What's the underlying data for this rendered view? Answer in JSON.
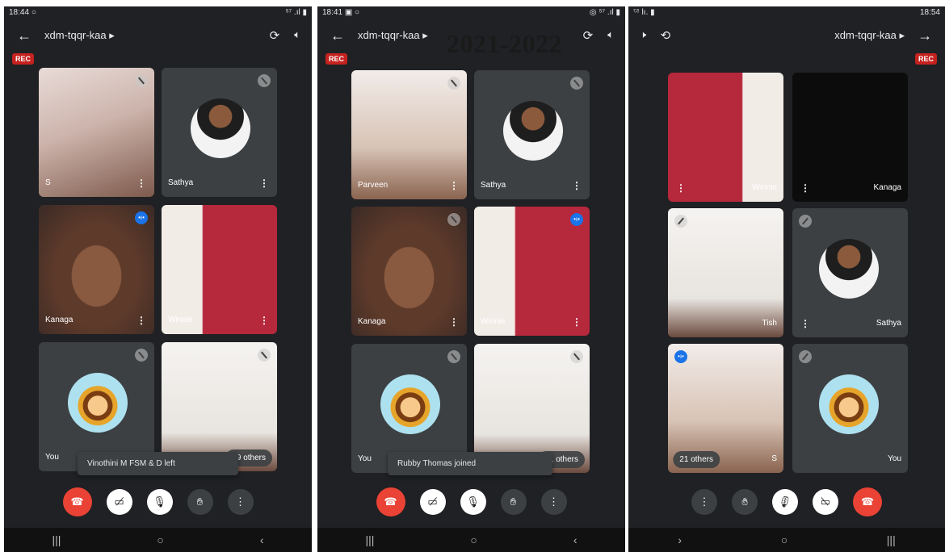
{
  "panel1": {
    "status_time": "18:44",
    "status_icons": "⁵⁷ .ıl ▮",
    "meeting_code": "xdm-tqqr-kaa ▸",
    "rec": "REC",
    "tiles": [
      {
        "name": "S"
      },
      {
        "name": "Sathya"
      },
      {
        "name": "Kanaga"
      },
      {
        "name": "Winnie"
      },
      {
        "name": "You"
      },
      {
        "name": ""
      }
    ],
    "others": "19 others",
    "toast": "Vinothini M FSM & D left"
  },
  "panel2": {
    "status_time": "18:41",
    "status_icons": "◎ ⁵⁷ .ıl ▮",
    "meeting_code": "xdm-tqqr-kaa ▸",
    "rec": "REC",
    "year_stamp": "2021-2022",
    "tiles": [
      {
        "name": "Parveen"
      },
      {
        "name": "Sathya"
      },
      {
        "name": "Kanaga"
      },
      {
        "name": "Winnie"
      },
      {
        "name": "You"
      },
      {
        "name": ""
      }
    ],
    "others": "21 others",
    "toast": "Rubby Thomas joined"
  },
  "panel3": {
    "status_time": "18:54",
    "meeting_code": "xdm-tqqr-kaa ▸",
    "rec": "REC",
    "tiles": [
      {
        "name": "Kanaga"
      },
      {
        "name": "Winnie"
      },
      {
        "name": "Tish"
      },
      {
        "name": "Sathya"
      },
      {
        "name": "S"
      },
      {
        "name": "You"
      }
    ],
    "others": "21 others"
  },
  "icons": {
    "back": "back-arrow-icon",
    "switch_camera": "switch-camera-icon",
    "speaker": "speaker-icon",
    "end_call": "end-call-icon",
    "camera_off": "camera-off-icon",
    "mic_off": "mic-off-icon",
    "hand": "raise-hand-icon",
    "more": "more-options-icon"
  },
  "colors": {
    "background": "#202124",
    "tile": "#3c4043",
    "rec": "#c5221f",
    "hangup": "#ea4335",
    "speaking": "#1a73e8"
  }
}
